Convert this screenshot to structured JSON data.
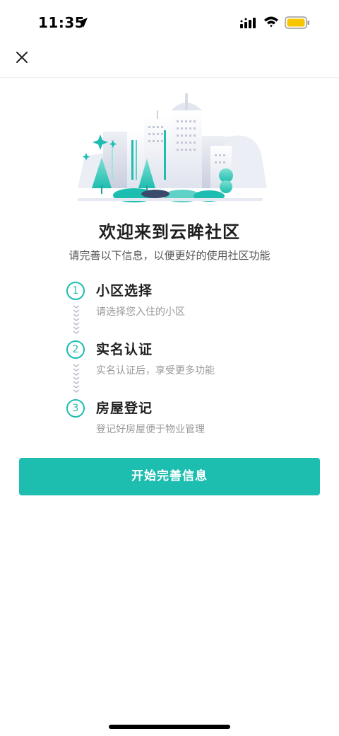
{
  "status_bar": {
    "time": "11:35",
    "icons": [
      "location-arrow-icon",
      "signal-icon",
      "wifi-icon",
      "battery-icon"
    ],
    "battery_color": "#f7c600"
  },
  "nav": {
    "close_icon": "close-icon"
  },
  "welcome": {
    "title": "欢迎来到云眸社区",
    "subtitle": "请完善以下信息，以便更好的使用社区功能"
  },
  "steps": [
    {
      "number": "1",
      "title": "小区选择",
      "desc": "请选择您入住的小区"
    },
    {
      "number": "2",
      "title": "实名认证",
      "desc": "实名认证后，享受更多功能"
    },
    {
      "number": "3",
      "title": "房屋登记",
      "desc": "登记好房屋便于物业管理"
    }
  ],
  "actions": {
    "start_label": "开始完善信息"
  },
  "colors": {
    "accent": "#1dbdb0",
    "title": "#1f1f1f",
    "muted": "#9a9a9a"
  }
}
